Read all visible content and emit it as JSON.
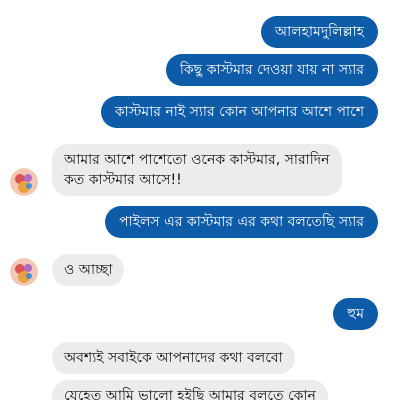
{
  "colors": {
    "outgoing_bubble": "#0e5ba8",
    "incoming_bubble": "#ececec",
    "background": "#ffffff"
  },
  "icons": {
    "contact_avatar": "contact-avatar-icon"
  },
  "messages": [
    {
      "direction": "outgoing",
      "text": "আলহামদুলিল্লাহ"
    },
    {
      "direction": "outgoing",
      "text": "কিছু কাস্টমার দেওয়া যায় না স্যার"
    },
    {
      "direction": "outgoing",
      "text": "কাস্টমার নাই স্যার কোন আপনার আশে পাশে"
    },
    {
      "direction": "incoming",
      "line1": "আমার আশে পাশেতো ওনেক কাস্টমার, সারাদিন",
      "line2": "কত কাস্টমার আসে!!"
    },
    {
      "direction": "outgoing",
      "text": "পাইলস এর কাস্টমার এর কথা বলতেছি স্যার"
    },
    {
      "direction": "incoming",
      "text": "ও আচ্ছা"
    },
    {
      "direction": "outgoing",
      "text": "হুম"
    },
    {
      "direction": "incoming",
      "text": "অবশ্যই সবাইকে আপনাদের কথা বলবো"
    },
    {
      "direction": "incoming",
      "text": "যেহেতু আমি ভালো হইছি আমার বলতে কোন"
    }
  ]
}
